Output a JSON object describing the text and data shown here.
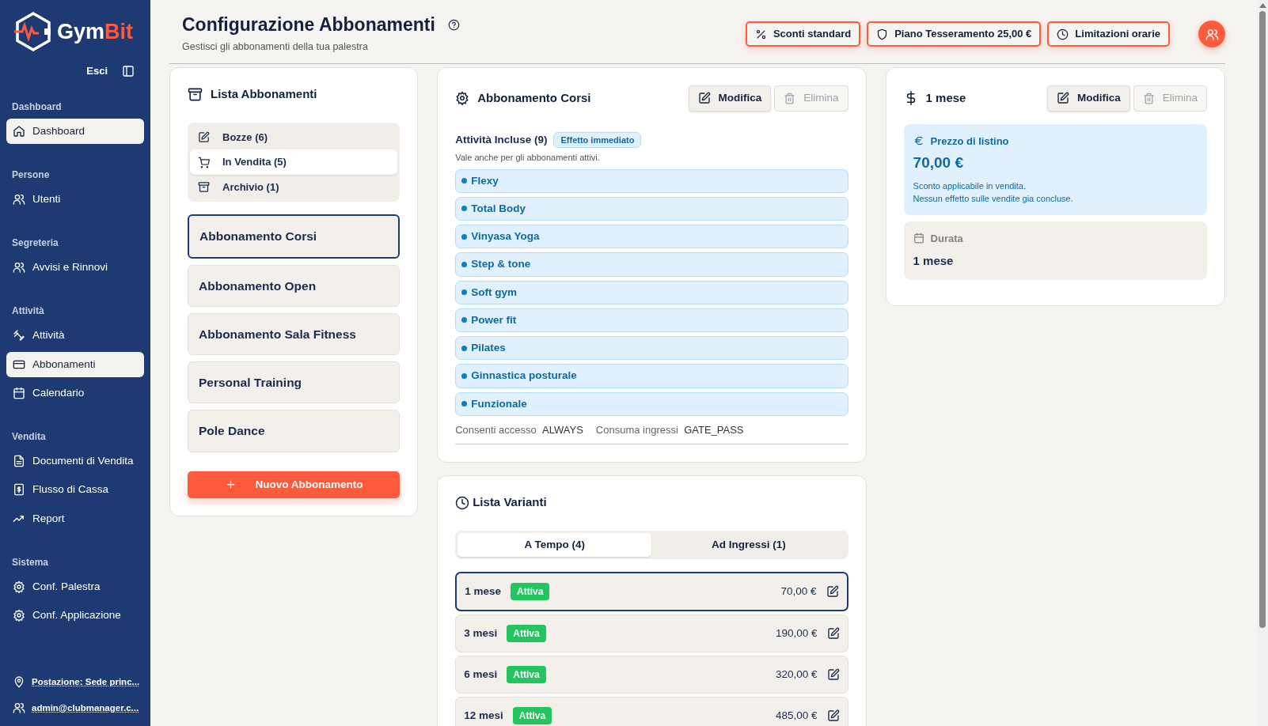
{
  "sidebar": {
    "logo": {
      "first": "Gym",
      "second": "Bit"
    },
    "logout": "Esci",
    "sections": [
      {
        "label": "Dashboard",
        "items": [
          {
            "label": "Dashboard",
            "selected": true
          }
        ]
      },
      {
        "label": "Persone",
        "items": [
          {
            "label": "Utenti",
            "selected": false
          }
        ]
      },
      {
        "label": "Segreteria",
        "items": [
          {
            "label": "Avvisi e Rinnovi",
            "selected": false
          }
        ]
      },
      {
        "label": "Attività",
        "items": [
          {
            "label": "Attività",
            "selected": false
          },
          {
            "label": "Abbonamenti",
            "selected": true
          },
          {
            "label": "Calendario",
            "selected": false
          }
        ]
      },
      {
        "label": "Vendita",
        "items": [
          {
            "label": "Documenti di Vendita",
            "selected": false
          },
          {
            "label": "Flusso di Cassa",
            "selected": false
          },
          {
            "label": "Report",
            "selected": false
          }
        ]
      },
      {
        "label": "Sistema",
        "items": [
          {
            "label": "Conf. Palestra",
            "selected": false
          },
          {
            "label": "Conf. Applicazione",
            "selected": false
          }
        ]
      }
    ],
    "footer": [
      "Postazione: Sede princ...",
      "admin@clubmanager.c..."
    ]
  },
  "header": {
    "title": "Configurazione Abbonamenti",
    "subtitle": "Gestisci gli abbonamenti della tua palestra",
    "actions": [
      "Sconti standard",
      "Piano Tesseramento 25,00 €",
      "Limitazioni orarie"
    ]
  },
  "list_card": {
    "title": "Lista Abbonamenti",
    "filters": [
      {
        "label": "Bozze (6)",
        "selected": false
      },
      {
        "label": "In Vendita (5)",
        "selected": true
      },
      {
        "label": "Archivio (1)",
        "selected": false
      }
    ],
    "subscriptions": [
      {
        "label": "Abbonamento Corsi",
        "selected": true
      },
      {
        "label": "Abbonamento Open",
        "selected": false
      },
      {
        "label": "Abbonamento Sala Fitness",
        "selected": false
      },
      {
        "label": "Personal Training",
        "selected": false
      },
      {
        "label": "Pole Dance",
        "selected": false
      }
    ],
    "new_button": "Nuovo Abbonamento"
  },
  "detail_card": {
    "title": "Abbonamento Corsi",
    "edit_button": {
      "label": "Modifica",
      "disabled": false
    },
    "delete_button": {
      "label": "Elimina",
      "disabled": true
    },
    "activities_label": "Attività Incluse (9)",
    "badge": "Effetto immediato",
    "note": "Vale anche per gli abbonamenti attivi.",
    "activities": [
      "Flexy",
      "Total Body",
      "Vinyasa Yoga",
      "Step & tone",
      "Soft gym",
      "Power fit",
      "Pilates",
      "Ginnastica posturale",
      "Funzionale"
    ],
    "access_label": "Consenti accesso",
    "access_value": "ALWAYS",
    "consume_label": "Consuma ingressi",
    "consume_value": "GATE_PASS"
  },
  "variants_card": {
    "title": "Lista Varianti",
    "tabs": [
      {
        "label": "A Tempo (4)",
        "selected": true
      },
      {
        "label": "Ad Ingressi (1)",
        "selected": false
      }
    ],
    "variants": [
      {
        "name": "1 mese",
        "status": "Attiva",
        "price": "70,00 €",
        "selected": true
      },
      {
        "name": "3 mesi",
        "status": "Attiva",
        "price": "190,00 €",
        "selected": false
      },
      {
        "name": "6 mesi",
        "status": "Attiva",
        "price": "320,00 €",
        "selected": false
      },
      {
        "name": "12 mesi",
        "status": "Attiva",
        "price": "485,00 €",
        "selected": false
      }
    ]
  },
  "variant_card": {
    "title": "1 mese",
    "edit_button": {
      "label": "Modifica",
      "disabled": false
    },
    "delete_button": {
      "label": "Elimina",
      "disabled": true
    },
    "price_label": "Prezzo di listino",
    "price": "70,00 €",
    "price_notes": [
      "Sconto applicabile in vendita.",
      "Nessun effetto sulle vendite gia concluse."
    ],
    "duration_label": "Durata",
    "duration_value": "1 mese"
  }
}
